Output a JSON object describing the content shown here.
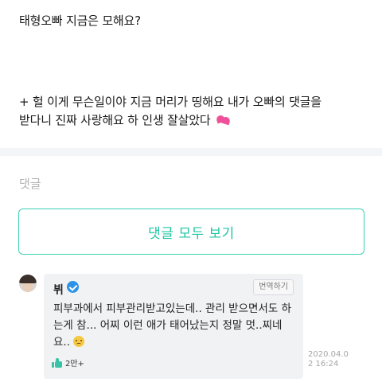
{
  "post": {
    "line1": "태형오빠 지금은 모해요?",
    "line2": "+ 헐 이게 무슨일이야 지금 머리가 띵해요 내가 오빠의 댓글을",
    "line3": "받다니 진짜 사랑해요 하 인생 잘살았다",
    "line3_emoji": "two-hearts-icon"
  },
  "comments": {
    "heading": "댓글",
    "view_all_label": "댓글 모두 보기",
    "items": [
      {
        "author": "뷔",
        "verified": true,
        "translate_label": "번역하기",
        "text": "피부과에서 피부관리받고있는데.. 관리 받으면서도 하는게 참... 어찌 이런 애가 태어났는지 정말 멋..찌네요..",
        "text_emoji": "pleading-face-icon",
        "likes": "2만+",
        "timestamp": "2020.04.02 16:24"
      }
    ]
  },
  "colors": {
    "accent": "#20c5a3",
    "verified": "#2d93e6",
    "heart": "#f0509a"
  }
}
